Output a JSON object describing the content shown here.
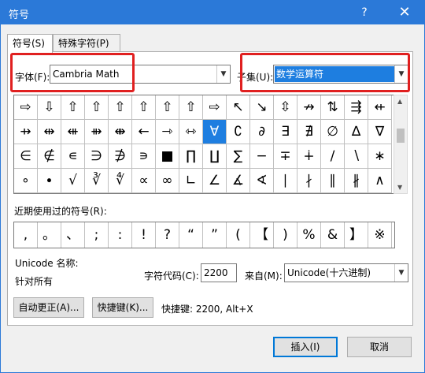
{
  "window": {
    "title": "符号",
    "help": "?",
    "close": "✕"
  },
  "tabs": [
    {
      "label": "符号(S)"
    },
    {
      "label": "特殊字符(P)"
    }
  ],
  "font": {
    "label": "字体(F):",
    "value": "Cambria Math"
  },
  "subset": {
    "label": "子集(U):",
    "value": "数学运算符"
  },
  "symbol_grid": [
    [
      "⇨",
      "⇩",
      "⇧",
      "⇧",
      "⇧",
      "⇧",
      "⇧",
      "⇧",
      "⇨",
      "↖",
      "↘",
      "⇳",
      "↛",
      "⇅",
      "⇶",
      "⇷"
    ],
    [
      "⇸",
      "⇹",
      "⇺",
      "⇻",
      "⇼",
      "←",
      "⇾",
      "⇿",
      "∀",
      "∁",
      "∂",
      "∃",
      "∄",
      "∅",
      "∆",
      "∇"
    ],
    [
      "∈",
      "∉",
      "∊",
      "∋",
      "∌",
      "∍",
      "■",
      "∏",
      "∐",
      "∑",
      "−",
      "∓",
      "∔",
      "∕",
      "∖",
      "∗"
    ],
    [
      "∘",
      "∙",
      "√",
      "∛",
      "∜",
      "∝",
      "∞",
      "∟",
      "∠",
      "∡",
      "∢",
      "∣",
      "∤",
      "∥",
      "∦",
      "∧"
    ]
  ],
  "selected": {
    "row": 1,
    "col": 8
  },
  "recent": {
    "label": "近期使用过的符号(R):",
    "symbols": [
      ",",
      "。",
      "、",
      ";",
      ":",
      "!",
      "?",
      "“",
      "”",
      "(",
      "【",
      ")",
      "%",
      "&",
      "】",
      "※"
    ]
  },
  "unicode_name": {
    "label": "Unicode 名称:",
    "value": "针对所有"
  },
  "char_code": {
    "label": "字符代码(C):",
    "value": "2200"
  },
  "from": {
    "label": "来自(M):",
    "value": "Unicode(十六进制)"
  },
  "buttons": {
    "autocorrect": "自动更正(A)...",
    "shortcut_key": "快捷键(K)...",
    "shortcut_text": "快捷键: 2200, Alt+X",
    "insert": "插入(I)",
    "cancel": "取消"
  },
  "colors": {
    "title_bar": "#2b79d8",
    "selection": "#1e7ee0",
    "highlight_box": "#e02020"
  }
}
